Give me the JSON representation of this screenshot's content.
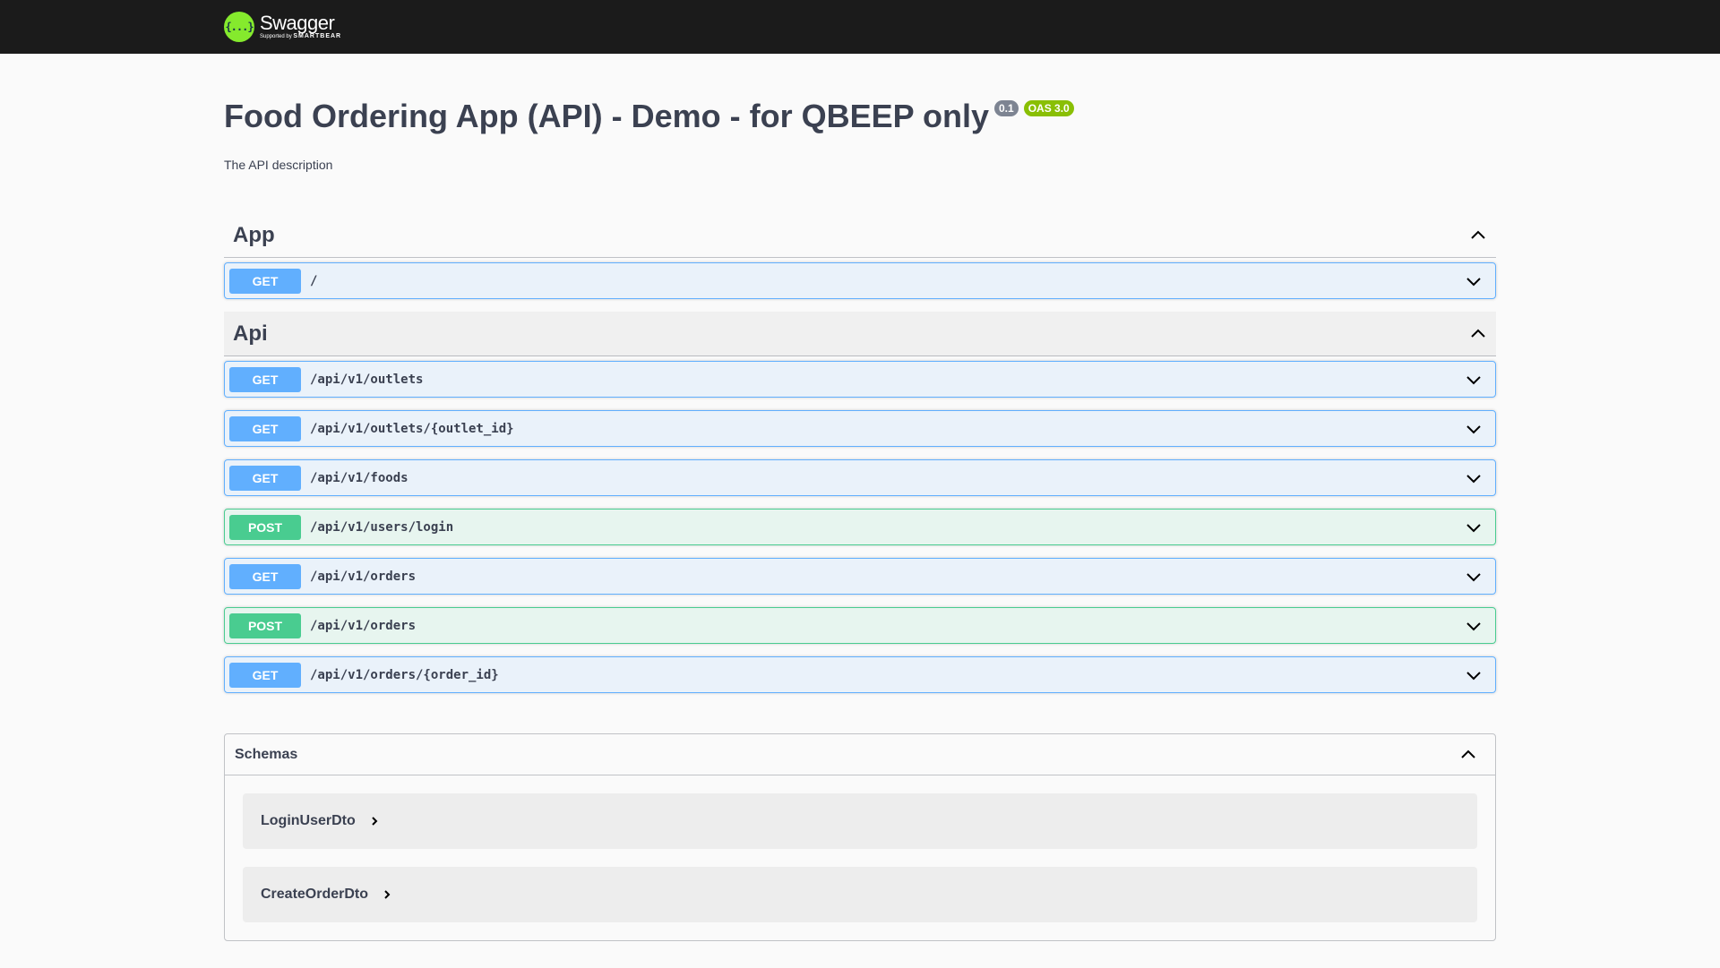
{
  "topbar": {
    "logo_mark": "{...}",
    "logo_name": "Swagger",
    "logo_supported": "Supported by",
    "logo_company": "SMARTBEAR"
  },
  "info": {
    "title": "Food Ordering App (API) - Demo - for QBEEP only",
    "version": "0.1",
    "oas": "OAS 3.0",
    "description": "The API description"
  },
  "tags": [
    {
      "name": "App",
      "operations": [
        {
          "method": "GET",
          "path": "/"
        }
      ]
    },
    {
      "name": "Api",
      "operations": [
        {
          "method": "GET",
          "path": "/api/v1/outlets"
        },
        {
          "method": "GET",
          "path": "/api/v1/outlets/{outlet_id}"
        },
        {
          "method": "GET",
          "path": "/api/v1/foods"
        },
        {
          "method": "POST",
          "path": "/api/v1/users/login"
        },
        {
          "method": "GET",
          "path": "/api/v1/orders"
        },
        {
          "method": "POST",
          "path": "/api/v1/orders"
        },
        {
          "method": "GET",
          "path": "/api/v1/orders/{order_id}"
        }
      ]
    }
  ],
  "schemas": {
    "title": "Schemas",
    "models": [
      "LoginUserDto",
      "CreateOrderDto"
    ]
  },
  "colors": {
    "get": "#61affe",
    "post": "#49cc90",
    "topbar": "#1b1b1b",
    "logo": "#85ea2d",
    "oas_badge": "#89bf04",
    "version_badge": "#7d8492"
  },
  "icons": {
    "collapse": "chevron-up-icon",
    "expand": "chevron-down-icon",
    "model_expand": "chevron-right-icon"
  }
}
